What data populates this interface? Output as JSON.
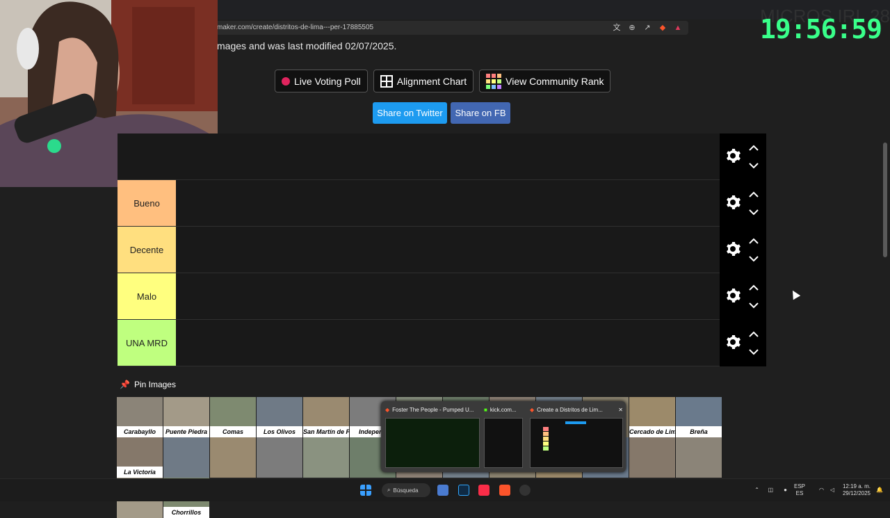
{
  "browser": {
    "url": "maker.com/create/distritos-de-lima---per-17885505",
    "icons": [
      "translate-icon",
      "zoom-icon",
      "share-icon",
      "brave-shield-icon",
      "brave-rewards-icon"
    ]
  },
  "overlay": {
    "clock": "19:56:59",
    "banner": "MICROS IRL 28"
  },
  "page": {
    "meta_text": "mages and was last modified 02/07/2025.",
    "buttons": {
      "live_poll": "Live Voting Poll",
      "alignment": "Alignment Chart",
      "community": "View Community Rank"
    },
    "share": {
      "twitter": "Share on Twitter",
      "fb": "Share on FB"
    },
    "tiers": [
      {
        "label": "",
        "color": "#191919"
      },
      {
        "label": "Bueno",
        "color": "#ffbf7f"
      },
      {
        "label": "Decente",
        "color": "#ffdf7f"
      },
      {
        "label": "Malo",
        "color": "#ffff7f"
      },
      {
        "label": "UNA MRD",
        "color": "#bfff7f"
      }
    ],
    "pin_label": "Pin Images",
    "images_row1": [
      "Carabayllo",
      "Puente Piedra",
      "Comas",
      "Los Olivos",
      "San Martín de Porres",
      "Independ",
      "",
      "",
      "",
      "",
      "",
      "Cercado de Lima",
      "Breña",
      "La Victoria"
    ],
    "images_row2": [
      "",
      "",
      "",
      "",
      "",
      "",
      "",
      "",
      "",
      "",
      "",
      "",
      "",
      "Chorrillos"
    ]
  },
  "taskbar_preview": {
    "tabs": [
      {
        "title": "Foster The People - Pumped U..."
      },
      {
        "title": "kick.com..."
      },
      {
        "title": "Create a Distritos de Lim..."
      }
    ]
  },
  "taskbar": {
    "search": "Búsqueda",
    "lang": "ESP",
    "lang2": "ES",
    "time": "12:19 a. m.",
    "date": "29/12/2025"
  }
}
